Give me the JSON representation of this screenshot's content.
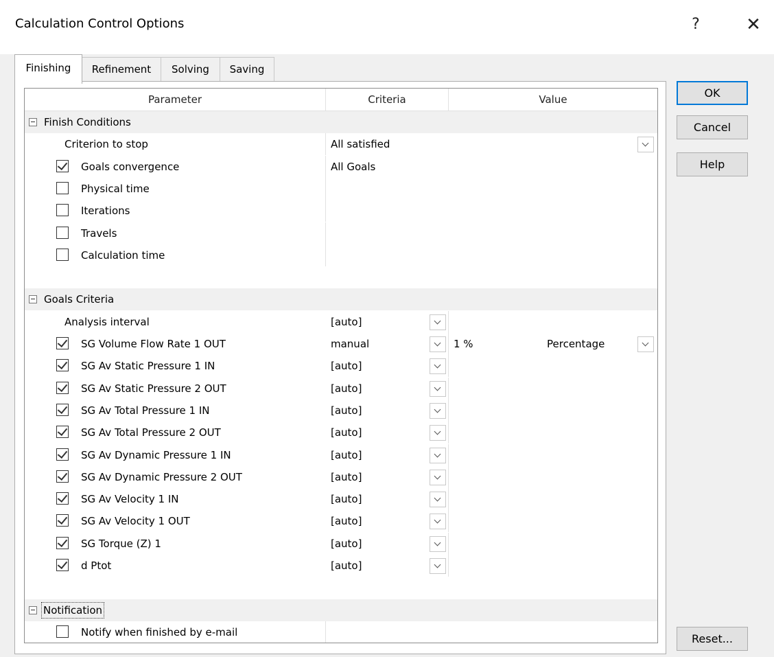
{
  "window": {
    "title": "Calculation Control Options",
    "help_label": "?",
    "close_label": "✕"
  },
  "tabs": [
    "Finishing",
    "Refinement",
    "Solving",
    "Saving"
  ],
  "columns": {
    "parameter": "Parameter",
    "criteria": "Criteria",
    "value": "Value"
  },
  "finish_conditions": {
    "title": "Finish Conditions",
    "criterion_to_stop": {
      "label": "Criterion to stop",
      "value": "All satisfied"
    },
    "items": [
      {
        "label": "Goals convergence",
        "checked": true,
        "criteria": "All Goals"
      },
      {
        "label": "Physical time",
        "checked": false,
        "criteria": ""
      },
      {
        "label": "Iterations",
        "checked": false,
        "criteria": ""
      },
      {
        "label": "Travels",
        "checked": false,
        "criteria": ""
      },
      {
        "label": "Calculation time",
        "checked": false,
        "criteria": ""
      }
    ]
  },
  "goals_criteria": {
    "title": "Goals Criteria",
    "analysis_interval": {
      "label": "Analysis interval",
      "criteria": "[auto]"
    },
    "goals": [
      {
        "label": "SG Volume Flow Rate 1 OUT",
        "checked": true,
        "criteria": "manual",
        "value": "1 %",
        "unit": "Percentage"
      },
      {
        "label": "SG Av Static Pressure 1 IN",
        "checked": true,
        "criteria": "[auto]"
      },
      {
        "label": "SG Av Static Pressure 2 OUT",
        "checked": true,
        "criteria": "[auto]"
      },
      {
        "label": "SG Av Total Pressure 1 IN",
        "checked": true,
        "criteria": "[auto]"
      },
      {
        "label": "SG Av Total Pressure 2 OUT",
        "checked": true,
        "criteria": "[auto]"
      },
      {
        "label": "SG Av Dynamic Pressure 1 IN",
        "checked": true,
        "criteria": "[auto]"
      },
      {
        "label": "SG Av Dynamic Pressure 2 OUT",
        "checked": true,
        "criteria": "[auto]"
      },
      {
        "label": "SG Av Velocity 1 IN",
        "checked": true,
        "criteria": "[auto]"
      },
      {
        "label": "SG Av Velocity 1 OUT",
        "checked": true,
        "criteria": "[auto]"
      },
      {
        "label": "SG Torque (Z) 1",
        "checked": true,
        "criteria": "[auto]"
      },
      {
        "label": "d Ptot",
        "checked": true,
        "criteria": "[auto]"
      }
    ]
  },
  "notification": {
    "title": "Notification",
    "items": [
      {
        "label": "Notify when finished by e-mail",
        "checked": false
      }
    ]
  },
  "buttons": {
    "ok": "OK",
    "cancel": "Cancel",
    "help": "Help",
    "reset": "Reset..."
  }
}
